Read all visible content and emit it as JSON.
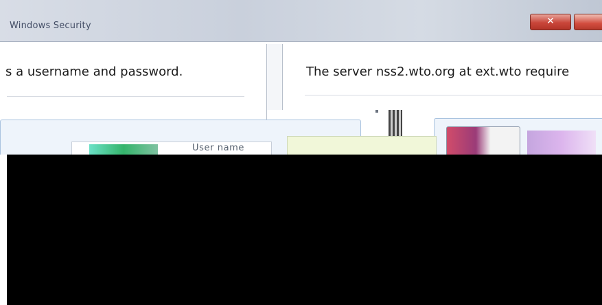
{
  "window": {
    "title": "Windows Security",
    "close_label": "✕"
  },
  "dialog": {
    "message_left": "s a username and password.",
    "message_right": "The server nss2.wto.org at ext.wto require"
  },
  "credentials": {
    "username_placeholder": "User name"
  }
}
